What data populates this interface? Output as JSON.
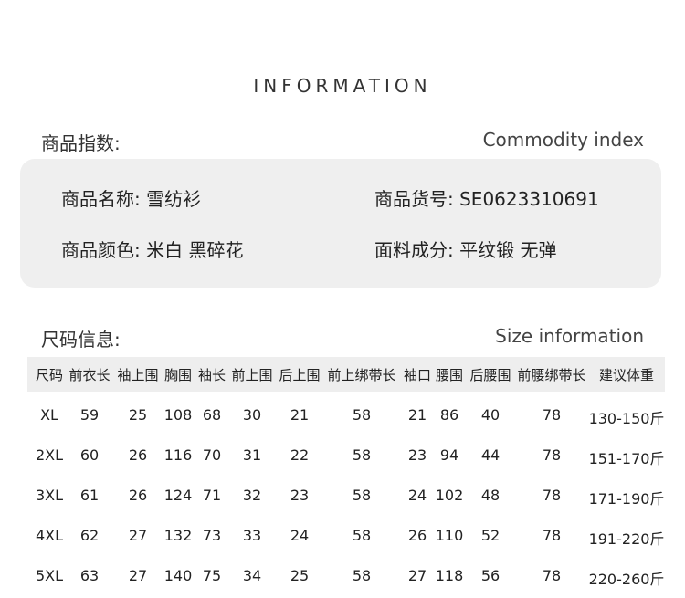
{
  "heading": "INFORMATION",
  "commodity": {
    "label_cn": "商品指数:",
    "label_en": "Commodity index",
    "name_label": "商品名称:",
    "name_value": "雪纺衫",
    "item_no_label": "商品货号:",
    "item_no_value": "SE0623310691",
    "color_label": "商品颜色:",
    "color_value": "米白 黑碎花",
    "fabric_label": "面料成分:",
    "fabric_value": "平纹锻 无弹"
  },
  "size_info": {
    "label_cn": "尺码信息:",
    "label_en": "Size information"
  },
  "size_table": {
    "columns": [
      "尺码",
      "前衣长",
      "袖上围",
      "胸围",
      "袖长",
      "前上围",
      "后上围",
      "前上绑带长",
      "袖口",
      "腰围",
      "后腰围",
      "前腰绑带长",
      "建议体重"
    ],
    "rows": [
      [
        "XL",
        "59",
        "25",
        "108",
        "68",
        "30",
        "21",
        "58",
        "21",
        "86",
        "40",
        "78",
        "130-150斤"
      ],
      [
        "2XL",
        "60",
        "26",
        "116",
        "70",
        "31",
        "22",
        "58",
        "23",
        "94",
        "44",
        "78",
        "151-170斤"
      ],
      [
        "3XL",
        "61",
        "26",
        "124",
        "71",
        "32",
        "23",
        "58",
        "24",
        "102",
        "48",
        "78",
        "171-190斤"
      ],
      [
        "4XL",
        "62",
        "27",
        "132",
        "73",
        "33",
        "24",
        "58",
        "26",
        "110",
        "52",
        "78",
        "191-220斤"
      ],
      [
        "5XL",
        "63",
        "27",
        "140",
        "75",
        "34",
        "25",
        "58",
        "27",
        "118",
        "56",
        "78",
        "220-260斤"
      ]
    ]
  }
}
